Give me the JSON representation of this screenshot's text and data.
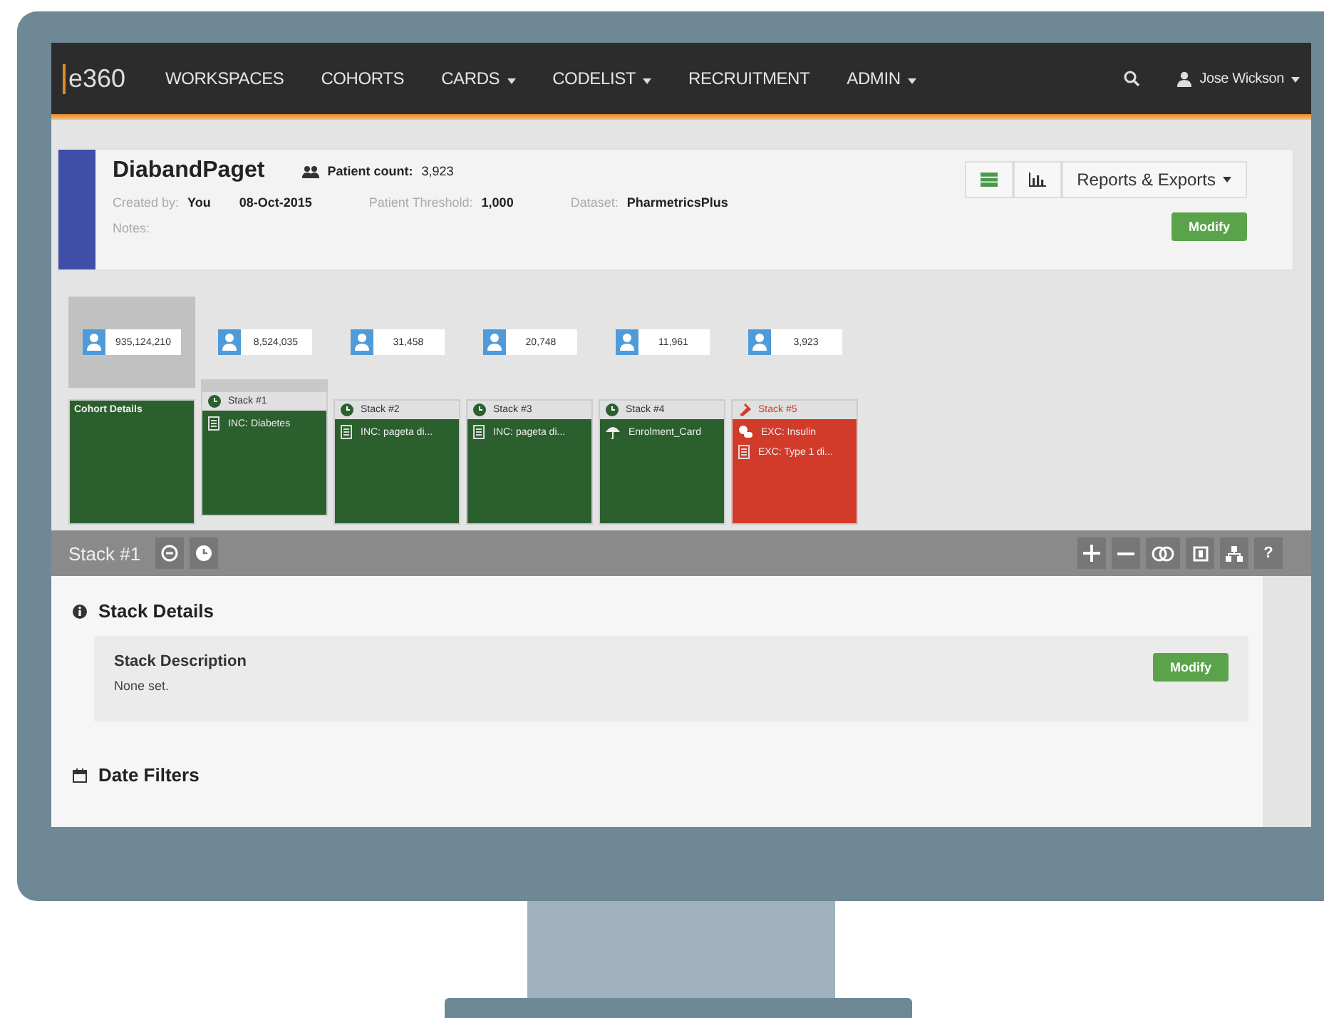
{
  "navbar": {
    "logo": "e360",
    "items": [
      {
        "label": "WORKSPACES",
        "dropdown": false
      },
      {
        "label": "COHORTS",
        "dropdown": false
      },
      {
        "label": "CARDS",
        "dropdown": true
      },
      {
        "label": "CODELIST",
        "dropdown": true
      },
      {
        "label": "RECRUITMENT",
        "dropdown": false
      },
      {
        "label": "ADMIN",
        "dropdown": true
      }
    ],
    "user": "Jose Wickson"
  },
  "cohort": {
    "name": "DiabandPaget",
    "patient_count_label": "Patient count:",
    "patient_count": "3,923",
    "created_by_label": "Created by:",
    "created_by": "You",
    "created_date": "08-Oct-2015",
    "threshold_label": "Patient Threshold:",
    "threshold": "1,000",
    "dataset_label": "Dataset:",
    "dataset": "PharmetricsPlus",
    "notes_label": "Notes:",
    "reports_button": "Reports & Exports",
    "modify_button": "Modify"
  },
  "cards": [
    {
      "kind": "cohort",
      "count": "935,124,210",
      "selected": true,
      "title": "Cohort Details"
    },
    {
      "kind": "include",
      "count": "8,524,035",
      "selected": true,
      "title": "Stack #1",
      "items": [
        {
          "kind": "list",
          "label": "INC: Diabetes"
        }
      ]
    },
    {
      "kind": "include",
      "count": "31,458",
      "selected": false,
      "title": "Stack #2",
      "items": [
        {
          "kind": "list",
          "label": "INC: pageta di..."
        }
      ]
    },
    {
      "kind": "include",
      "count": "20,748",
      "selected": false,
      "title": "Stack #3",
      "items": [
        {
          "kind": "list",
          "label": "INC: pageta di..."
        }
      ]
    },
    {
      "kind": "include",
      "count": "11,961",
      "selected": false,
      "title": "Stack #4",
      "items": [
        {
          "kind": "umbrella",
          "label": "Enrolment_Card"
        }
      ]
    },
    {
      "kind": "exclude",
      "count": "3,923",
      "selected": false,
      "title": "Stack #5",
      "items": [
        {
          "kind": "pills",
          "label": "EXC: Insulin"
        },
        {
          "kind": "list",
          "label": "EXC: Type 1 di..."
        }
      ]
    }
  ],
  "stack_bar": {
    "title": "Stack #1",
    "help": "?"
  },
  "stack_details": {
    "heading": "Stack Details",
    "description_title": "Stack Description",
    "description": "None set.",
    "modify_button": "Modify"
  },
  "date_filters": {
    "heading": "Date Filters"
  }
}
